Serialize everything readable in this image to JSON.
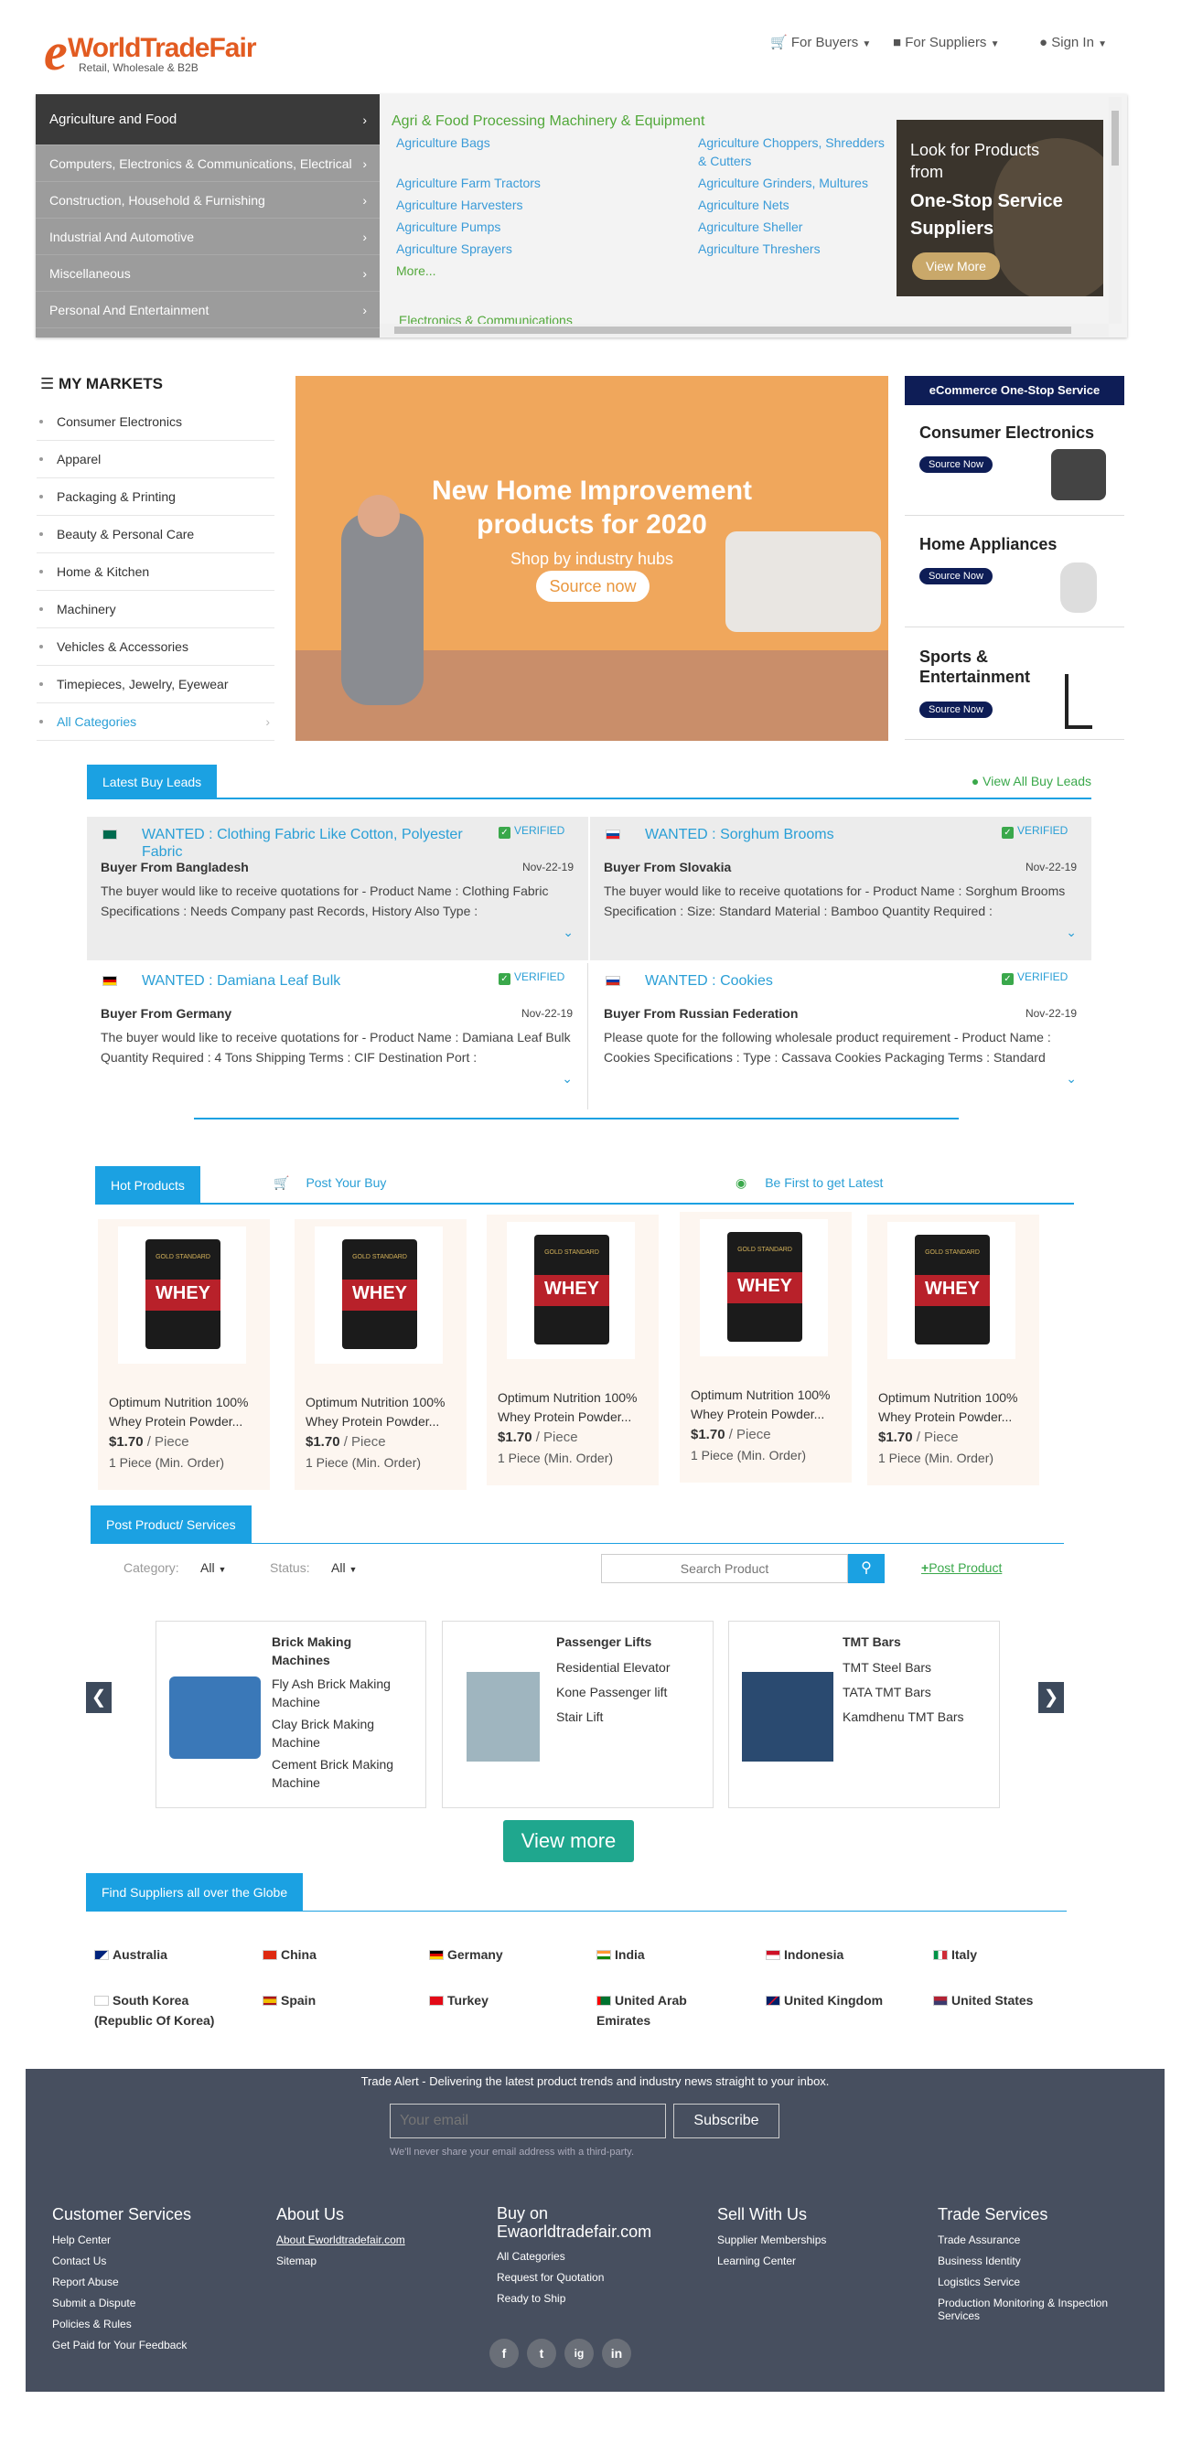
{
  "header": {
    "logo_letter": "e",
    "logo_text": "WorldTradeFair",
    "logo_subtitle": "Retail, Wholesale & B2B",
    "nav": [
      {
        "label": "For Buyers"
      },
      {
        "label": "For Suppliers"
      },
      {
        "label": "Sign In"
      }
    ]
  },
  "categories": {
    "items": [
      {
        "label": "Agriculture and Food"
      },
      {
        "label": "Computers, Electronics & Communications, Electrical"
      },
      {
        "label": "Construction, Household & Furnishing"
      },
      {
        "label": "Industrial And Automotive"
      },
      {
        "label": "Miscellaneous"
      },
      {
        "label": "Personal And Entertainment"
      }
    ],
    "sub_heading": "Agri & Food Processing Machinery & Equipment",
    "sub_links": [
      "Agriculture Bags",
      "Agriculture Choppers, Shredders & Cutters",
      "Agriculture Farm Tractors",
      "Agriculture Grinders, Multures",
      "Agriculture Harvesters",
      "Agriculture Nets",
      "Agriculture Pumps",
      "Agriculture Sheller",
      "Agriculture Sprayers",
      "Agriculture Threshers"
    ],
    "more": "More...",
    "sub_heading2": "Electronics & Communications",
    "promo": {
      "line1": "Look for Products",
      "line2": "from",
      "line3": "One-Stop Service",
      "line4": "Suppliers",
      "button": "View More"
    }
  },
  "markets": {
    "title": "MY MARKETS",
    "items": [
      "Consumer Electronics",
      "Apparel",
      "Packaging & Printing",
      "Beauty & Personal Care",
      "Home & Kitchen",
      "Machinery",
      "Vehicles & Accessories",
      "Timepieces, Jewelry, Eyewear",
      "All Categories"
    ]
  },
  "banner": {
    "line1": "New Home Improvement",
    "line2": "products for 2020",
    "sub": "Shop by industry hubs",
    "button": "Source now"
  },
  "one_stop": {
    "header": "eCommerce One-Stop Service",
    "items": [
      {
        "title": "Consumer Electronics",
        "button": "Source Now"
      },
      {
        "title": "Home Appliances",
        "button": "Source Now"
      },
      {
        "title": "Sports &\nEntertainment",
        "button": "Source Now"
      }
    ]
  },
  "leads": {
    "tab": "Latest Buy Leads",
    "view_all": "View All Buy Leads",
    "verified": "VERIFIED",
    "items": [
      {
        "title": "WANTED : Clothing Fabric Like Cotton, Polyester Fabric",
        "buyer": "Buyer From Bangladesh",
        "date": "Nov-22-19",
        "text": "The buyer would like to receive quotations for - Product Name : Clothing Fabric Specifications : Needs Company past Records, History Also Type :",
        "flag": "Bangladesh"
      },
      {
        "title": "WANTED : Sorghum Brooms",
        "buyer": "Buyer From Slovakia",
        "date": "Nov-22-19",
        "text": "The buyer would like to receive quotations for - Product Name : Sorghum Brooms Specification : Size: Standard Material : Bamboo Quantity Required :",
        "flag": "Slovakia"
      },
      {
        "title": "WANTED : Damiana Leaf Bulk",
        "buyer": "Buyer From Germany",
        "date": "Nov-22-19",
        "text": "The buyer would like to receive quotations for - Product Name : Damiana Leaf Bulk Quantity Required : 4 Tons Shipping Terms : CIF Destination Port :",
        "flag": "Germany"
      },
      {
        "title": "WANTED : Cookies",
        "buyer": "Buyer From Russian Federation",
        "date": "Nov-22-19",
        "text": "Please quote for the following wholesale product requirement - Product Name : Cookies Specifications : Type : Cassava Cookies Packaging Terms : Standard",
        "flag": "Russia"
      }
    ]
  },
  "hot": {
    "tab": "Hot Products",
    "post_buy": "Post Your Buy",
    "be_first": "Be First to get Latest",
    "product": {
      "name": "Optimum Nutrition 100% Whey Protein Powder...",
      "price": "$1.70",
      "unit": "/ Piece",
      "min": "1 Piece (Min. Order)",
      "bag_brand": "GOLD STANDARD",
      "bag_word": "WHEY"
    }
  },
  "post": {
    "tab": "Post Product/ Services",
    "category_label": "Category:",
    "category_value": "All",
    "status_label": "Status:",
    "status_value": "All",
    "search_placeholder": "Search Product",
    "post_link": "Post Product",
    "cards": [
      {
        "title": "Brick Making Machines",
        "items": [
          "Fly Ash Brick Making Machine",
          "Clay Brick Making Machine",
          "Cement Brick Making Machine"
        ]
      },
      {
        "title": "Passenger Lifts",
        "items": [
          "Residential Elevator",
          "Kone Passenger lift",
          "Stair Lift"
        ]
      },
      {
        "title": "TMT Bars",
        "items": [
          "TMT Steel Bars",
          "TATA TMT Bars",
          "Kamdhenu TMT Bars"
        ]
      }
    ],
    "view_more": "View more"
  },
  "suppliers": {
    "tab": "Find Suppliers all over the Globe",
    "countries": [
      "Australia",
      "China",
      "Germany",
      "India",
      "Indonesia",
      "Italy",
      "South Korea (Republic Of Korea)",
      "Spain",
      "Turkey",
      "United Arab Emirates",
      "United Kingdom",
      "United States"
    ]
  },
  "footer": {
    "alert": "Trade Alert - Delivering the latest product trends and industry news straight to your inbox.",
    "email_placeholder": "Your email",
    "subscribe": "Subscribe",
    "privacy": "We'll never share your email address with a third-party.",
    "columns": [
      {
        "title": "Customer Services",
        "links": [
          "Help Center",
          "Contact Us",
          "Report Abuse",
          "Submit a Dispute",
          "Policies & Rules",
          "Get Paid for Your Feedback"
        ]
      },
      {
        "title": "About Us",
        "links": [
          "About Eworldtradefair.com",
          "Sitemap"
        ]
      },
      {
        "title": "Buy on Ewaorldtradefair.com",
        "links": [
          "All Categories",
          "Request for Quotation",
          "Ready to Ship"
        ]
      },
      {
        "title": "Sell With Us",
        "links": [
          "Supplier Memberships",
          "Learning Center"
        ]
      },
      {
        "title": "Trade Services",
        "links": [
          "Trade Assurance",
          "Business Identity",
          "Logistics Service",
          "Production Monitoring & Inspection Services"
        ]
      }
    ],
    "social": [
      "f",
      "t",
      "ig",
      "in"
    ]
  }
}
